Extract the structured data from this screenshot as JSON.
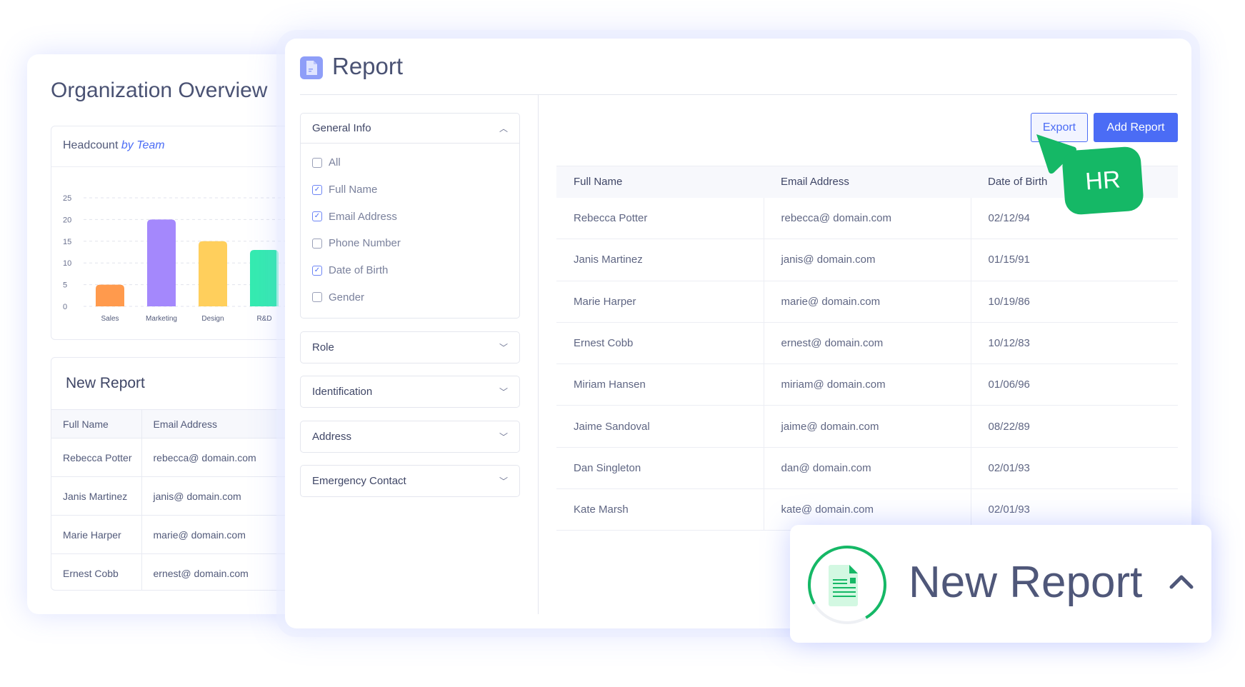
{
  "overview": {
    "title": "Organization Overview",
    "headcount": {
      "title": "Headcount",
      "title_em": "by Team"
    },
    "new_report": {
      "title": "New Report",
      "columns": [
        "Full Name",
        "Email Address"
      ],
      "rows": [
        [
          "Rebecca Potter",
          "rebecca@ domain.com"
        ],
        [
          "Janis Martinez",
          "janis@ domain.com"
        ],
        [
          "Marie Harper",
          "marie@ domain.com"
        ],
        [
          "Ernest Cobb",
          "ernest@ domain.com"
        ]
      ]
    }
  },
  "chart_data": {
    "type": "bar",
    "categories": [
      "Sales",
      "Marketing",
      "Design",
      "R&D"
    ],
    "values": [
      5,
      20,
      15,
      13
    ],
    "yticks": [
      "0",
      "5",
      "10",
      "15",
      "20",
      "25"
    ],
    "ylim": [
      0,
      25
    ],
    "grid": true,
    "colors": [
      "#ff9a4d",
      "#a488fc",
      "#ffcf5c",
      "#35ebb0"
    ]
  },
  "report": {
    "title": "Report",
    "general_info": {
      "label": "General Info",
      "options": [
        {
          "label": "All",
          "checked": false
        },
        {
          "label": "Full Name",
          "checked": true
        },
        {
          "label": "Email Address",
          "checked": true
        },
        {
          "label": "Phone Number",
          "checked": false
        },
        {
          "label": "Date of Birth",
          "checked": true
        },
        {
          "label": "Gender",
          "checked": false
        }
      ]
    },
    "sections": [
      "Role",
      "Identification",
      "Address",
      "Emergency Contact"
    ],
    "export_label": "Export",
    "add_label": "Add Report",
    "columns": [
      "Full Name",
      "Email Address",
      "Date of Birth"
    ],
    "rows": [
      [
        "Rebecca Potter",
        "rebecca@ domain.com",
        "02/12/94"
      ],
      [
        "Janis Martinez",
        "janis@ domain.com",
        "01/15/91"
      ],
      [
        "Marie Harper",
        "marie@ domain.com",
        "10/19/86"
      ],
      [
        "Ernest Cobb",
        "ernest@ domain.com",
        "10/12/83"
      ],
      [
        "Miriam Hansen",
        "miriam@ domain.com",
        "01/06/96"
      ],
      [
        "Jaime Sandoval",
        "jaime@ domain.com",
        "08/22/89"
      ],
      [
        "Dan Singleton",
        "dan@ domain.com",
        "02/01/93"
      ],
      [
        "Kate Marsh",
        "kate@ domain.com",
        "02/01/93"
      ]
    ]
  },
  "cursor_badge": "HR",
  "floating": {
    "title": "New Report",
    "progress": 0.75
  },
  "colors": {
    "accent": "#4b6cf5",
    "green": "#15b866"
  }
}
